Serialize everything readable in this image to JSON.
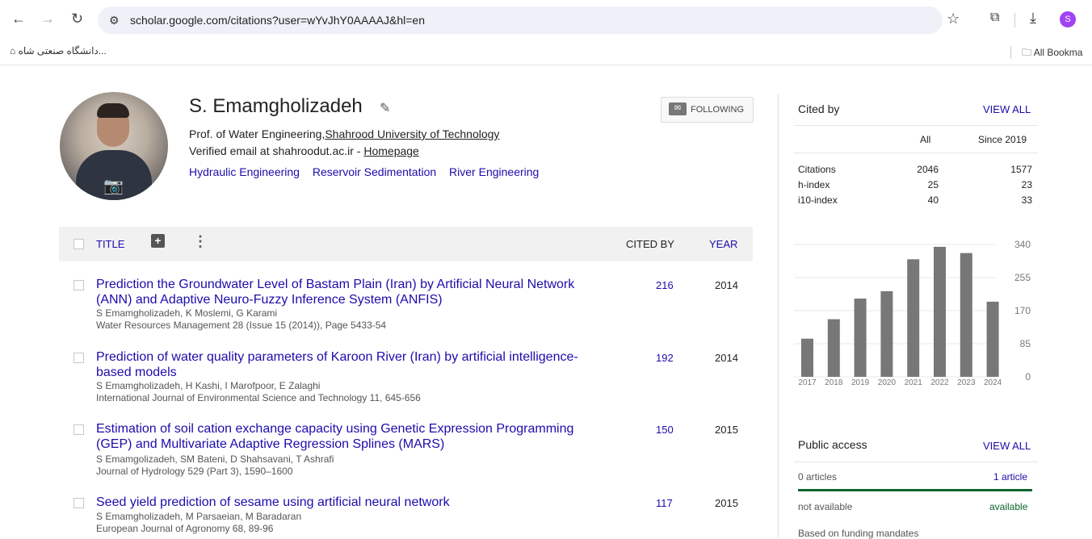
{
  "browser": {
    "url": "scholar.google.com/citations?user=wYvJhY0AAAAJ&hl=en",
    "profile_initial": "S",
    "bookmark": "دانشگاه صنعتی شاه...",
    "all_bookmarks": "All Bookma"
  },
  "profile": {
    "name": "S. Emamgholizadeh",
    "affiliation_prefix": "Prof. of Water Engineering,",
    "affiliation_link": "Shahrood University of Technology",
    "email_text": "Verified email at shahroodut.ac.ir - ",
    "homepage": "Homepage",
    "interests": [
      "Hydraulic Engineering",
      "Reservoir Sedimentation",
      "River Engineering"
    ],
    "follow_label": "FOLLOWING"
  },
  "table": {
    "title_header": "TITLE",
    "cited_header": "CITED BY",
    "year_header": "YEAR",
    "rows": [
      {
        "title": "Prediction the Groundwater Level of Bastam Plain (Iran) by Artificial Neural Network (ANN) and Adaptive Neuro-Fuzzy Inference System (ANFIS)",
        "authors": "S Emamgholizadeh, K Moslemi, G Karami",
        "journal": "Water Resources Management 28 (Issue 15 (2014)), Page 5433-54",
        "cited": "216",
        "year": "2014"
      },
      {
        "title": "Prediction of water quality parameters of Karoon River (Iran) by artificial intelligence-based models",
        "authors": "S Emamgholizadeh, H Kashi, I Marofpoor, E Zalaghi",
        "journal": "International Journal of Environmental Science and Technology 11, 645-656",
        "cited": "192",
        "year": "2014"
      },
      {
        "title": "Estimation of soil cation exchange capacity using Genetic Expression Programming (GEP) and Multivariate Adaptive Regression Splines (MARS)",
        "authors": "S Emamgolizadeh, SM Bateni, D Shahsavani, T Ashrafi",
        "journal": "Journal of Hydrology 529 (Part 3), 1590–1600",
        "cited": "150",
        "year": "2015"
      },
      {
        "title": "Seed yield prediction of sesame using artificial neural network",
        "authors": "S Emamgholizadeh, M Parsaeian, M Baradaran",
        "journal": "European Journal of Agronomy 68, 89-96",
        "cited": "117",
        "year": "2015"
      }
    ]
  },
  "cited_by": {
    "heading": "Cited by",
    "view_all": "VIEW ALL",
    "col_all": "All",
    "col_since": "Since 2019",
    "metrics": [
      {
        "label": "Citations",
        "all": "2046",
        "since": "1577"
      },
      {
        "label": "h-index",
        "all": "25",
        "since": "23"
      },
      {
        "label": "i10-index",
        "all": "40",
        "since": "33"
      }
    ]
  },
  "chart_data": {
    "type": "bar",
    "categories": [
      "2017",
      "2018",
      "2019",
      "2020",
      "2021",
      "2022",
      "2023",
      "2024"
    ],
    "values": [
      98,
      148,
      201,
      220,
      302,
      334,
      318,
      193
    ],
    "yticks": [
      "340",
      "255",
      "170",
      "85",
      "0"
    ],
    "ylim": [
      0,
      340
    ],
    "bar_color": "#777777"
  },
  "public_access": {
    "heading": "Public access",
    "view_all": "VIEW ALL",
    "left_count": "0 articles",
    "right_count": "1 article",
    "left_status": "not available",
    "right_status": "available",
    "note": "Based on funding mandates"
  }
}
